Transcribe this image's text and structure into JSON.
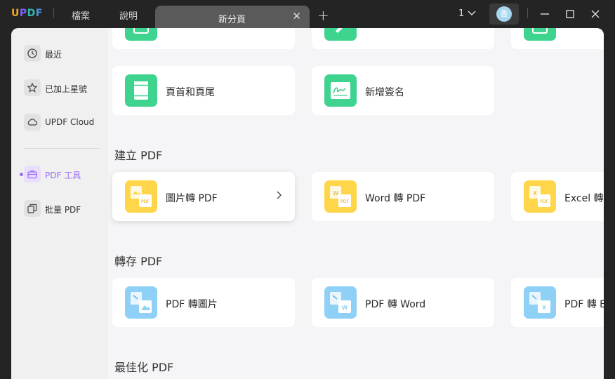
{
  "titlebar": {
    "logo": {
      "u": "U",
      "p": "P",
      "d": "D",
      "f": "F"
    },
    "menus": [
      "檔案",
      "說明"
    ],
    "tab_label": "新分頁",
    "tab_close": "✕",
    "new_tab": "+",
    "page_count": "1",
    "avatar_text": "善"
  },
  "sidebar": {
    "items": [
      {
        "label": "最近",
        "icon": "clock-icon"
      },
      {
        "label": "已加上星號",
        "icon": "star-icon"
      },
      {
        "label": "UPDF Cloud",
        "icon": "cloud-icon"
      },
      {
        "label": "PDF 工具",
        "icon": "toolbox-icon",
        "active": true
      },
      {
        "label": "批量 PDF",
        "icon": "batch-icon"
      }
    ]
  },
  "top_row": {
    "labels": [
      "",
      "",
      ""
    ]
  },
  "edit_row": {
    "cards": [
      {
        "label": "頁首和頁尾",
        "icon": "header-footer-icon"
      },
      {
        "label": "新增簽名",
        "icon": "signature-icon"
      }
    ]
  },
  "sections": {
    "create": {
      "title": "建立 PDF",
      "cards": [
        {
          "label": "圖片轉 PDF",
          "icon": "image-to-pdf-icon"
        },
        {
          "label": "Word 轉 PDF",
          "icon": "word-to-pdf-icon"
        },
        {
          "label": "Excel 轉 PDF",
          "icon": "excel-to-pdf-icon"
        }
      ]
    },
    "export": {
      "title": "轉存 PDF",
      "cards": [
        {
          "label": "PDF 轉圖片",
          "icon": "pdf-to-image-icon"
        },
        {
          "label": "PDF 轉 Word",
          "icon": "pdf-to-word-icon"
        },
        {
          "label": "PDF 轉 Excel",
          "icon": "pdf-to-excel-icon"
        }
      ]
    },
    "optimize": {
      "title": "最佳化 PDF"
    }
  },
  "colors": {
    "accent": "#9c6cf5",
    "green_icon": "#3ed38e",
    "yellow_icon": "#ffd54a",
    "blue_icon": "#8fd0f6"
  }
}
